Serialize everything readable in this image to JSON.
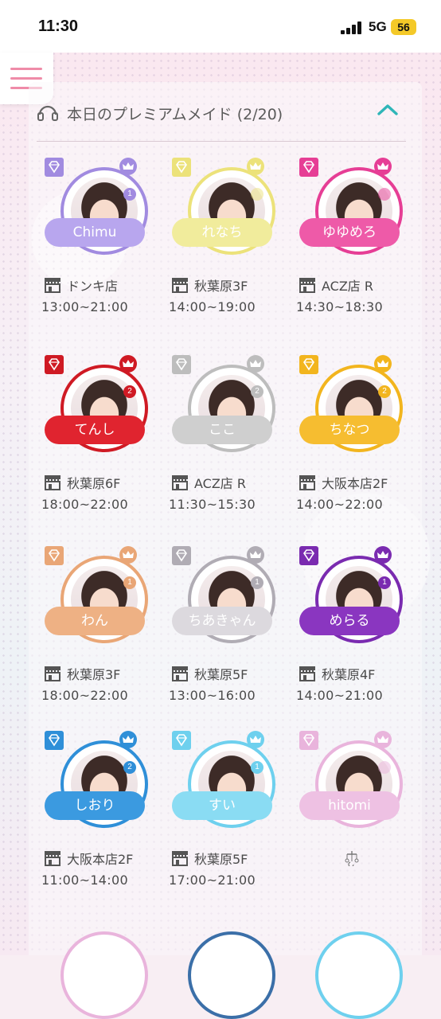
{
  "status": {
    "time": "11:30",
    "network": "5G",
    "battery": "56"
  },
  "header": {
    "title": "本日のプレミアムメイド (2/20)",
    "toggle_icon": "chevron-up-icon"
  },
  "maids": [
    {
      "name": "Chimu",
      "rank": "1",
      "store": "ドンキ店",
      "hours": "13:00~21:00",
      "color": "#a18be0",
      "bar": "#b8a6ee"
    },
    {
      "name": "れなち",
      "rank": "",
      "store": "秋葉原3F",
      "hours": "14:00~19:00",
      "color": "#ece27a",
      "bar": "#f1ec9c"
    },
    {
      "name": "ゆゆめろ",
      "rank": "",
      "store": "ACZ店 R",
      "hours": "14:30~18:30",
      "color": "#e63e95",
      "bar": "#ee5aa8"
    },
    {
      "name": "てんし",
      "rank": "2",
      "store": "秋葉原6F",
      "hours": "18:00~22:00",
      "color": "#cf1a24",
      "bar": "#e0242f"
    },
    {
      "name": "ここ",
      "rank": "2",
      "store": "ACZ店 R",
      "hours": "11:30~15:30",
      "color": "#bdbdbd",
      "bar": "#cfcfcf"
    },
    {
      "name": "ちなつ",
      "rank": "2",
      "store": "大阪本店2F",
      "hours": "14:00~22:00",
      "color": "#f2b51e",
      "bar": "#f6bd30"
    },
    {
      "name": "わん",
      "rank": "1",
      "store": "秋葉原3F",
      "hours": "18:00~22:00",
      "color": "#e9a676",
      "bar": "#eeb184"
    },
    {
      "name": "ちあきゃん",
      "rank": "1",
      "store": "秋葉原5F",
      "hours": "13:00~16:00",
      "color": "#b0acb4",
      "bar": "#dcd9de"
    },
    {
      "name": "めらる",
      "rank": "1",
      "store": "秋葉原4F",
      "hours": "14:00~21:00",
      "color": "#7a2bb0",
      "bar": "#8a36c0"
    },
    {
      "name": "しおり",
      "rank": "2",
      "store": "大阪本店2F",
      "hours": "11:00~14:00",
      "color": "#2f8fd8",
      "bar": "#3b9ae0"
    },
    {
      "name": "すい",
      "rank": "1",
      "store": "秋葉原5F",
      "hours": "17:00~21:00",
      "color": "#6ed0ee",
      "bar": "#8adcf3"
    },
    {
      "name": "hitomi",
      "rank": "",
      "store": "",
      "hours": "",
      "color": "#e9b4dc",
      "bar": "#eec1e3"
    }
  ]
}
